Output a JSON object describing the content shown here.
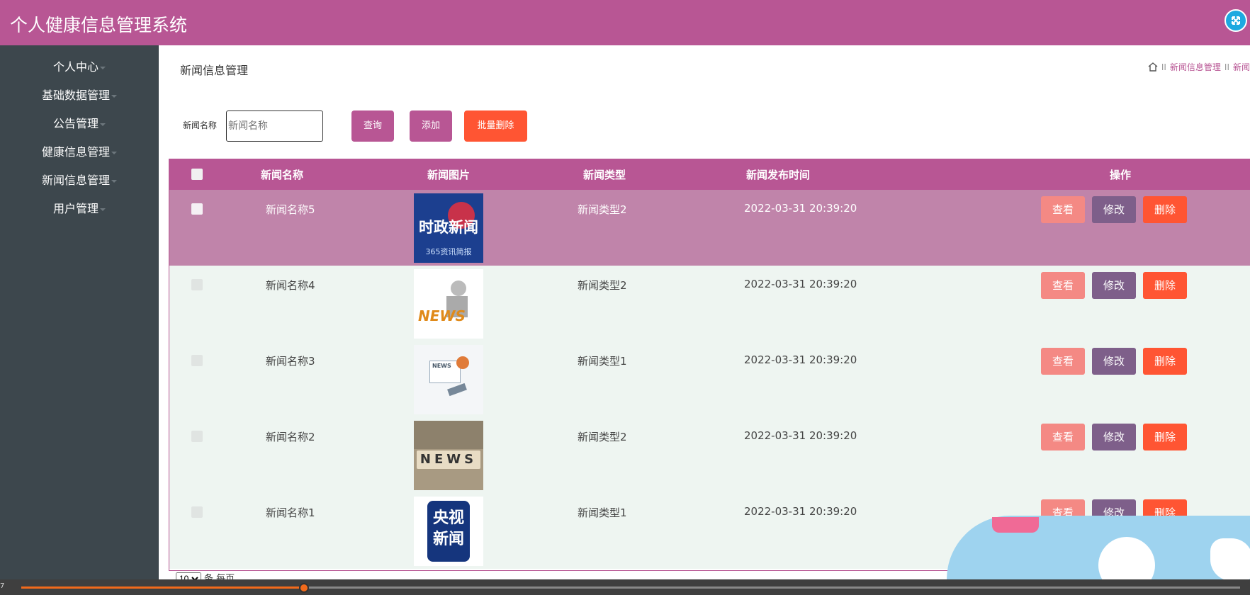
{
  "header": {
    "title": "个人健康信息管理系统",
    "fullscreen_icon": "expand-icon"
  },
  "sidebar": {
    "items": [
      {
        "label": "个人中心"
      },
      {
        "label": "基础数据管理"
      },
      {
        "label": "公告管理"
      },
      {
        "label": "健康信息管理"
      },
      {
        "label": "新闻信息管理"
      },
      {
        "label": "用户管理"
      }
    ]
  },
  "page": {
    "title": "新闻信息管理",
    "breadcrumb": [
      "新闻信息管理",
      "新闻"
    ]
  },
  "search": {
    "label": "新闻名称",
    "placeholder": "新闻名称",
    "query_label": "查询",
    "add_label": "添加",
    "bulk_delete_label": "批量删除"
  },
  "table": {
    "columns": [
      "新闻名称",
      "新闻图片",
      "新闻类型",
      "新闻发布时间",
      "操作"
    ],
    "rows": [
      {
        "name": "新闻名称5",
        "type": "新闻类型2",
        "time": "2022-03-31 20:39:20",
        "selected": true,
        "image_text": "时政新闻",
        "image_sub": "365资讯简报"
      },
      {
        "name": "新闻名称4",
        "type": "新闻类型2",
        "time": "2022-03-31 20:39:20",
        "selected": false,
        "image_text": "NEWS"
      },
      {
        "name": "新闻名称3",
        "type": "新闻类型1",
        "time": "2022-03-31 20:39:20",
        "selected": false,
        "image_text": "NEWS"
      },
      {
        "name": "新闻名称2",
        "type": "新闻类型2",
        "time": "2022-03-31 20:39:20",
        "selected": false,
        "image_text": "NEWS"
      },
      {
        "name": "新闻名称1",
        "type": "新闻类型1",
        "time": "2022-03-31 20:39:20",
        "selected": false,
        "image_text": "央视新闻"
      }
    ],
    "actions": {
      "view": "查看",
      "edit": "修改",
      "delete": "删除"
    }
  },
  "pager": {
    "page_size": "10",
    "suffix": "条 每页"
  },
  "video": {
    "time": "7"
  }
}
